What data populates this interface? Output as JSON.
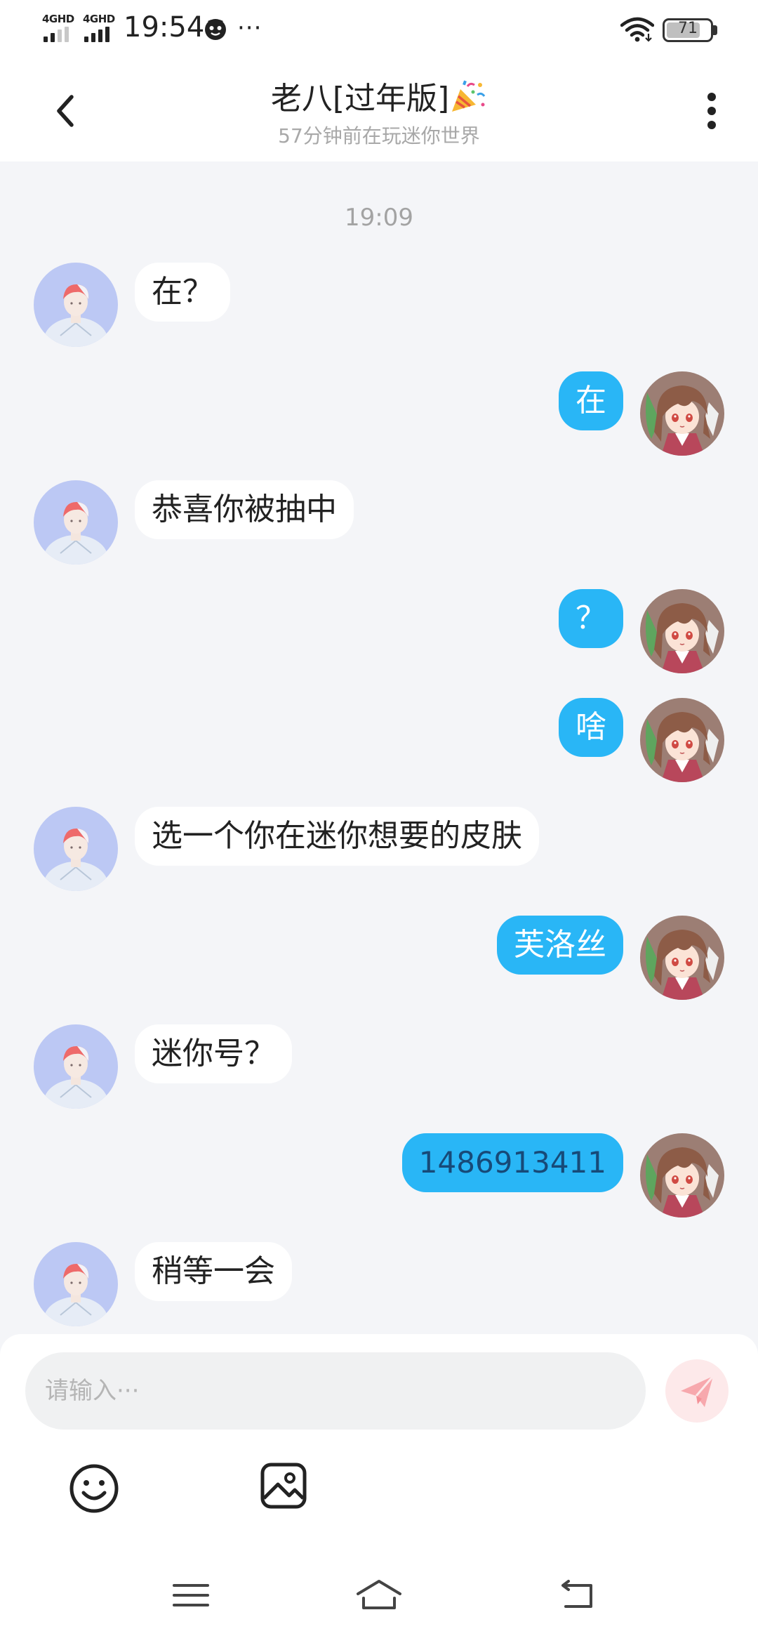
{
  "status_bar": {
    "signal1_label": "4GHD",
    "signal2_label": "4GHD",
    "time": "19:54",
    "more_indicator": "···",
    "battery_level": "71"
  },
  "header": {
    "title": "老八[过年版]",
    "subtitle": "57分钟前在玩迷你世界"
  },
  "chat": {
    "timestamp": "19:09",
    "messages": [
      {
        "side": "in",
        "text": "在？"
      },
      {
        "side": "out",
        "text": "在"
      },
      {
        "side": "in",
        "text": "恭喜你被抽中"
      },
      {
        "side": "out",
        "text": "？"
      },
      {
        "side": "out",
        "text": "啥"
      },
      {
        "side": "in",
        "text": "选一个你在迷你想要的皮肤"
      },
      {
        "side": "out",
        "text": "芙洛丝"
      },
      {
        "side": "in",
        "text": "迷你号？"
      },
      {
        "side": "out",
        "text": "1486913411"
      },
      {
        "side": "in",
        "text": "稍等一会"
      }
    ]
  },
  "input": {
    "placeholder": "请输入···"
  },
  "icons": {
    "back": "chevron-left-icon",
    "menu": "more-vertical-icon",
    "send": "paper-plane-icon",
    "emoji": "smiley-icon",
    "image": "image-icon"
  },
  "colors": {
    "accent_bubble": "#29b6f6",
    "background": "#f4f5f8",
    "send_button_bg": "#fde9ea",
    "send_icon": "#f7a8ad"
  }
}
